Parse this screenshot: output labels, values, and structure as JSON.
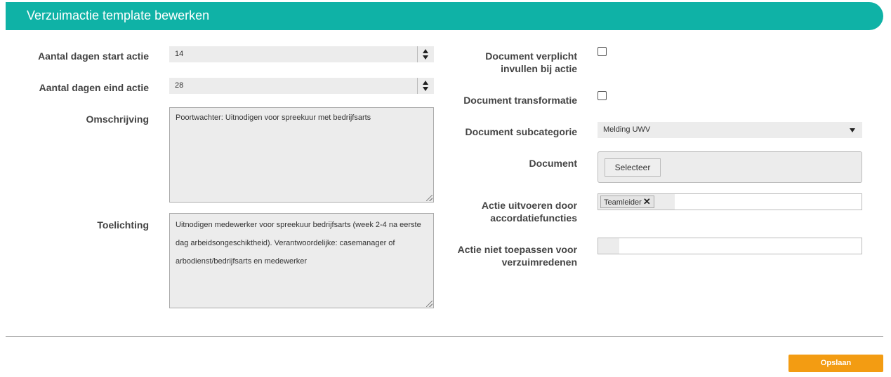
{
  "header": {
    "title": "Verzuimactie template bewerken"
  },
  "left": {
    "start_label": "Aantal dagen start actie",
    "start_value": "14",
    "end_label": "Aantal dagen eind actie",
    "end_value": "28",
    "description_label": "Omschrijving",
    "description_value": "Poortwachter: Uitnodigen voor spreekuur met bedrijfsarts",
    "explanation_label": "Toelichting",
    "explanation_value": "Uitnodigen medewerker voor spreekuur bedrijfsarts (week 2-4 na eerste dag arbeidsongeschiktheid). Verantwoordelijke: casemanager of arbodienst/bedrijfsarts en medewerker"
  },
  "right": {
    "doc_required_label_1": "Document verplicht",
    "doc_required_label_2": "invullen bij actie",
    "doc_required_checked": false,
    "doc_transform_label": "Document transformatie",
    "doc_transform_checked": false,
    "subcategory_label": "Document subcategorie",
    "subcategory_value": "Melding UWV",
    "document_label": "Document",
    "select_button_label": "Selecteer",
    "executor_label_1": "Actie uitvoeren door",
    "executor_label_2": "accordatiefuncties",
    "executor_tags": [
      "Teamleider"
    ],
    "exclude_label_1": "Actie niet toepassen voor",
    "exclude_label_2": "verzuimredenen"
  },
  "footer": {
    "save_label": "Opslaan"
  },
  "colors": {
    "header": "#0fb2a6",
    "save_button": "#f39c12",
    "field_bg": "#ececec"
  }
}
